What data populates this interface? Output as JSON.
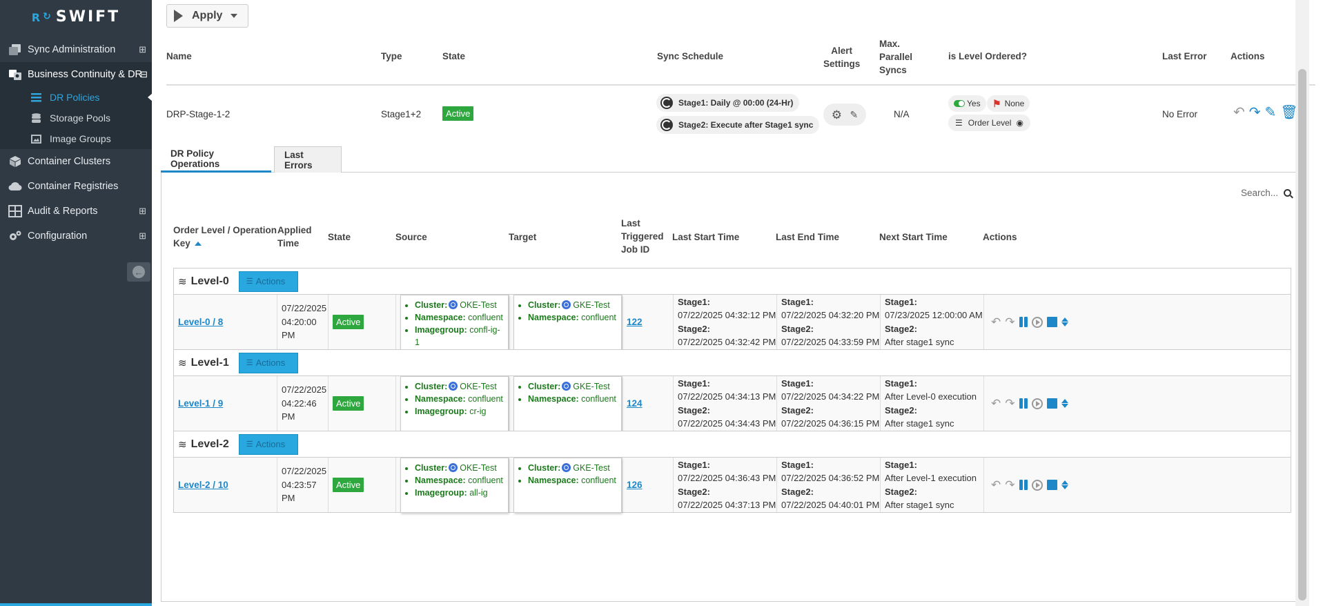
{
  "app": {
    "logo_text": "SWIFT",
    "logo_mark": "R"
  },
  "sidebar": {
    "items": [
      {
        "label": "Sync Administration",
        "icon": "copy-icon",
        "expandable": true
      },
      {
        "label": "Business Continuity & DR",
        "icon": "dr-icon",
        "expandable": true,
        "expanded": true
      }
    ],
    "sub_items": [
      {
        "label": "DR Policies",
        "icon": "list-icon",
        "active": true
      },
      {
        "label": "Storage Pools",
        "icon": "database-icon"
      },
      {
        "label": "Image Groups",
        "icon": "image-icon"
      }
    ],
    "items_after": [
      {
        "label": "Container Clusters",
        "icon": "cube-icon"
      },
      {
        "label": "Container Registries",
        "icon": "cloud-icon"
      },
      {
        "label": "Audit & Reports",
        "icon": "grid-icon",
        "expandable": true
      },
      {
        "label": "Configuration",
        "icon": "cogs-icon",
        "expandable": true
      }
    ],
    "expand_symbol": "⊞",
    "collapse_symbol": "⊟"
  },
  "toolbar": {
    "apply_label": "Apply"
  },
  "policy_table": {
    "headers": {
      "name": "Name",
      "type": "Type",
      "state": "State",
      "sync_schedule": "Sync Schedule",
      "alert_settings_1": "Alert",
      "alert_settings_2": "Settings",
      "max_parallel_1": "Max.",
      "max_parallel_2": "Parallel",
      "max_parallel_3": "Syncs",
      "level_ordered": "is Level Ordered?",
      "last_error": "Last Error",
      "actions": "Actions"
    },
    "row": {
      "name": "DRP-Stage-1-2",
      "type": "Stage1+2",
      "state": "Active",
      "schedule_1": "Stage1: Daily @ 00:00 (24-Hr)",
      "schedule_2": "Stage2: Execute after Stage1 sync",
      "max_parallel": "N/A",
      "level_ordered_yes": "Yes",
      "level_ordered_none": "None",
      "order_level": "Order Level",
      "last_error": "No Error"
    }
  },
  "tabs": [
    {
      "label": "DR Policy Operations",
      "active": true
    },
    {
      "label": "Last Errors",
      "active": false
    }
  ],
  "search": {
    "placeholder": "Search..."
  },
  "ops_table": {
    "headers": {
      "order_level_1": "Order Level / Operation",
      "order_level_2": "Key",
      "applied_1": "Applied",
      "applied_2": "Time",
      "state": "State",
      "source": "Source",
      "target": "Target",
      "last_job_1": "Last",
      "last_job_2": "Triggered",
      "last_job_3": "Job ID",
      "last_start": "Last Start Time",
      "last_end": "Last End Time",
      "next_start": "Next Start Time",
      "actions": "Actions"
    },
    "level_actions_label": "Actions",
    "labels": {
      "cluster": "Cluster:",
      "namespace": "Namespace:",
      "imagegroup": "Imagegroup:",
      "stage1": "Stage1:",
      "stage2": "Stage2:"
    },
    "levels": [
      {
        "title": "Level-0",
        "op": {
          "key": "Level-0 / 8",
          "applied_date": "07/22/2025",
          "applied_time": "04:20:00 PM",
          "state": "Active",
          "source_cluster": "OKE-Test",
          "source_namespace": "confluent",
          "source_imagegroup": "confl-ig-1",
          "target_cluster": "GKE-Test",
          "target_namespace": "confluent",
          "job_id": "122",
          "start_s1": "07/22/2025 04:32:12 PM",
          "start_s2": "07/22/2025 04:32:42 PM",
          "end_s1": "07/22/2025 04:32:20 PM",
          "end_s2": "07/22/2025 04:33:59 PM",
          "next_s1": "07/23/2025 12:00:00 AM",
          "next_s2": "After stage1 sync"
        }
      },
      {
        "title": "Level-1",
        "op": {
          "key": "Level-1 / 9",
          "applied_date": "07/22/2025",
          "applied_time": "04:22:46 PM",
          "state": "Active",
          "source_cluster": "OKE-Test",
          "source_namespace": "confluent",
          "source_imagegroup": "cr-ig",
          "target_cluster": "GKE-Test",
          "target_namespace": "confluent",
          "job_id": "124",
          "start_s1": "07/22/2025 04:34:13 PM",
          "start_s2": "07/22/2025 04:34:43 PM",
          "end_s1": "07/22/2025 04:34:22 PM",
          "end_s2": "07/22/2025 04:36:15 PM",
          "next_s1": "After Level-0 execution",
          "next_s2": "After stage1 sync"
        }
      },
      {
        "title": "Level-2",
        "op": {
          "key": "Level-2 / 10",
          "applied_date": "07/22/2025",
          "applied_time": "04:23:57 PM",
          "state": "Active",
          "source_cluster": "OKE-Test",
          "source_namespace": "confluent",
          "source_imagegroup": "all-ig",
          "target_cluster": "GKE-Test",
          "target_namespace": "confluent",
          "job_id": "126",
          "start_s1": "07/22/2025 04:36:43 PM",
          "start_s2": "07/22/2025 04:37:13 PM",
          "end_s1": "07/22/2025 04:36:52 PM",
          "end_s2": "07/22/2025 04:40:01 PM",
          "next_s1": "After Level-1 execution",
          "next_s2": "After stage1 sync"
        }
      }
    ]
  },
  "colors": {
    "sidebar_bg": "#2f3a45",
    "accent": "#29a8e0",
    "active_green": "#2ea83e",
    "link_blue": "#1e87c8"
  }
}
